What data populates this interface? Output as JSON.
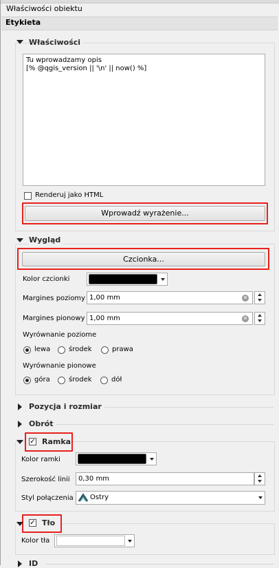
{
  "window": {
    "title": "Właściwości obiektu"
  },
  "panel": {
    "title": "Etykieta"
  },
  "properties": {
    "title": "Właściwości",
    "text_lines": [
      "Tu wprowadzamy opis",
      "[% @qgis_version || '\\n' || now() %]"
    ],
    "render_html_label": "Renderuj jako HTML",
    "render_html_checked": false,
    "expression_button": "Wprowadź wyrażenie..."
  },
  "appearance": {
    "title": "Wygląd",
    "font_button": "Czcionka...",
    "font_color_label": "Kolor czcionki",
    "font_color": "#000000",
    "margin_h_label": "Margines poziomy",
    "margin_h_value": "1,00 mm",
    "margin_v_label": "Margines pionowy",
    "margin_v_value": "1,00 mm",
    "halign_label": "Wyrównanie poziome",
    "halign_options": [
      "lewa",
      "środek",
      "prawa"
    ],
    "halign_selected": "lewa",
    "valign_label": "Wyrównanie pionowe",
    "valign_options": [
      "góra",
      "środek",
      "dół"
    ],
    "valign_selected": "góra"
  },
  "position": {
    "title": "Pozycja i rozmiar"
  },
  "rotation": {
    "title": "Obrót"
  },
  "frame": {
    "title": "Ramka",
    "checked": true,
    "color_label": "Kolor ramki",
    "color": "#000000",
    "width_label": "Szerokość linii",
    "width_value": "0,30 mm",
    "join_label": "Styl połączenia",
    "join_value": "Ostry",
    "join_icon": "miter-join-icon"
  },
  "background": {
    "title": "Tło",
    "checked": true,
    "color_label": "Kolor tła",
    "color": "#ffffff"
  },
  "next_group": {
    "title": "ID"
  },
  "highlight_color": "#e8201c"
}
